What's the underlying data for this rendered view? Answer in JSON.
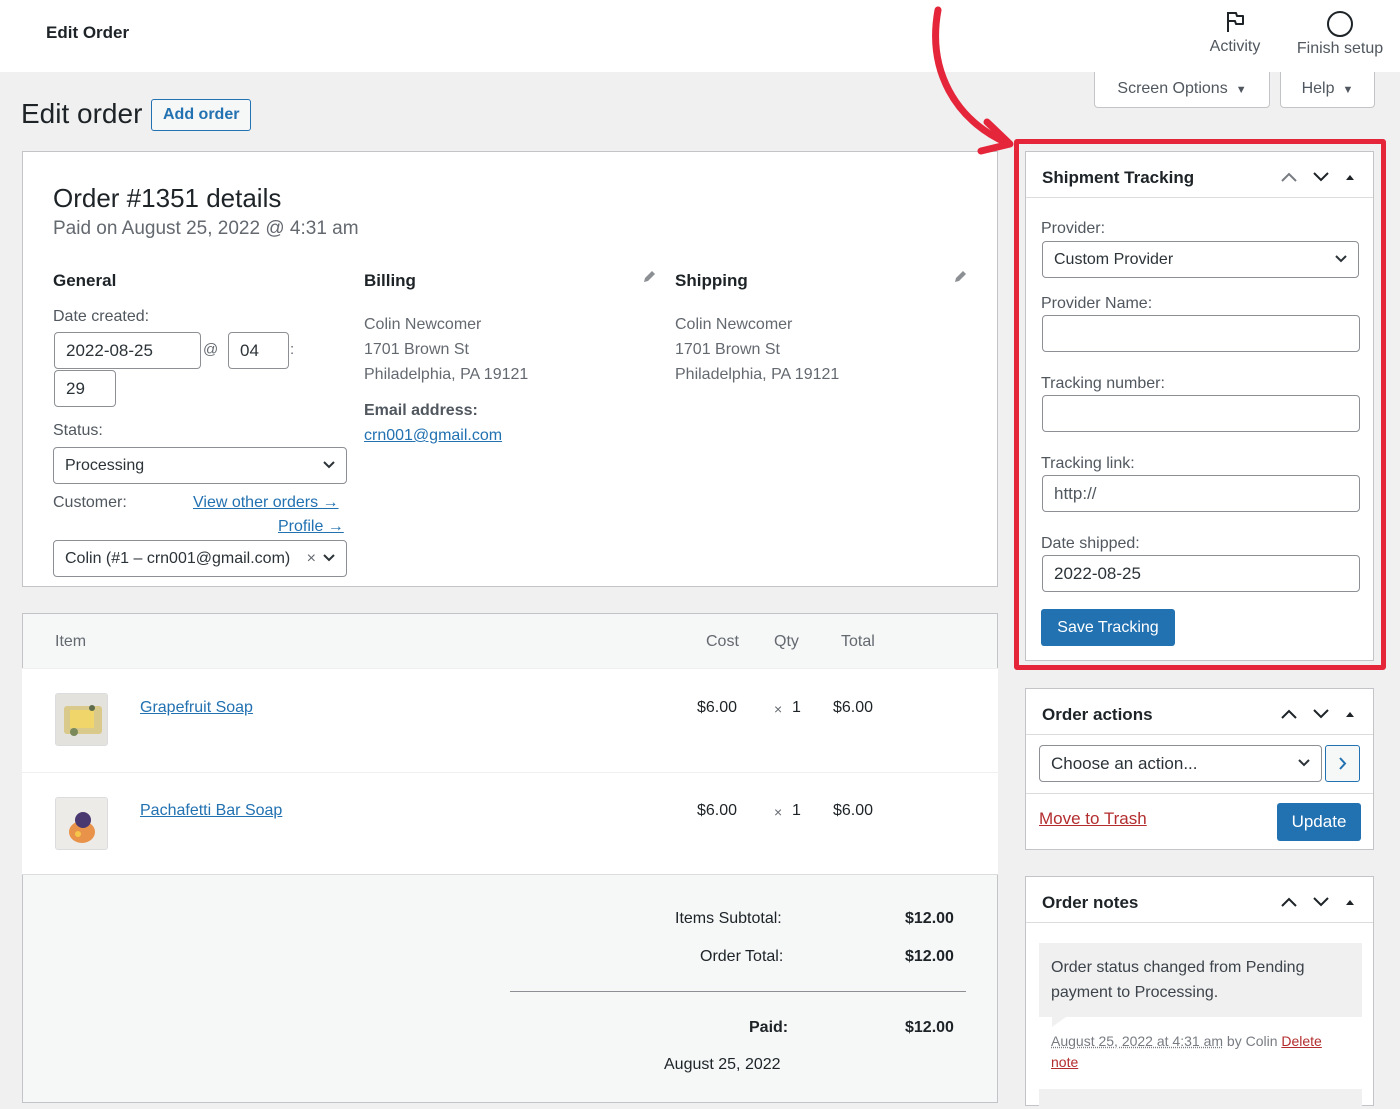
{
  "header": {
    "title": "Edit Order",
    "activity_label": "Activity",
    "finish_setup_label": "Finish setup",
    "screen_options_label": "Screen Options",
    "help_label": "Help"
  },
  "page": {
    "heading": "Edit order",
    "add_order_label": "Add order"
  },
  "order": {
    "title": "Order #1351 details",
    "paid_on": "Paid on August 25, 2022 @ 4:31 am",
    "general": {
      "heading": "General",
      "date_created_label": "Date created:",
      "date": "2022-08-25",
      "at": "@",
      "hour": "04",
      "colon": ":",
      "minute": "29",
      "status_label": "Status:",
      "status_value": "Processing",
      "customer_label": "Customer:",
      "view_other_orders": "View other orders →",
      "profile": "Profile →",
      "customer_value": "Colin (#1 – crn001@gmail.com)",
      "clear_symbol": "×"
    },
    "billing": {
      "heading": "Billing",
      "name": "Colin Newcomer",
      "street": "1701 Brown St",
      "city": "Philadelphia, PA 19121",
      "email_label": "Email address:",
      "email": "crn001@gmail.com"
    },
    "shipping": {
      "heading": "Shipping",
      "name": "Colin Newcomer",
      "street": "1701 Brown St",
      "city": "Philadelphia, PA 19121"
    }
  },
  "items": {
    "columns": {
      "item": "Item",
      "cost": "Cost",
      "qty": "Qty",
      "total": "Total"
    },
    "rows": [
      {
        "name": "Grapefruit Soap",
        "cost": "$6.00",
        "times": "×",
        "qty": "1",
        "total": "$6.00"
      },
      {
        "name": "Pachafetti Bar Soap",
        "cost": "$6.00",
        "times": "×",
        "qty": "1",
        "total": "$6.00"
      }
    ],
    "totals": {
      "subtotal_label": "Items Subtotal:",
      "subtotal_value": "$12.00",
      "order_total_label": "Order Total:",
      "order_total_value": "$12.00",
      "paid_label": "Paid:",
      "paid_value": "$12.00",
      "paid_date": "August 25, 2022"
    }
  },
  "shipment_tracking": {
    "title": "Shipment Tracking",
    "provider_label": "Provider:",
    "provider_value": "Custom Provider",
    "provider_name_label": "Provider Name:",
    "provider_name_value": "",
    "tracking_number_label": "Tracking number:",
    "tracking_number_value": "",
    "tracking_link_label": "Tracking link:",
    "tracking_link_placeholder": "http://",
    "date_shipped_label": "Date shipped:",
    "date_shipped_value": "2022-08-25",
    "save_label": "Save Tracking"
  },
  "order_actions": {
    "title": "Order actions",
    "action_select": "Choose an action...",
    "move_to_trash": "Move to Trash",
    "update_label": "Update"
  },
  "order_notes": {
    "title": "Order notes",
    "note_text": "Order status changed from Pending payment to Processing.",
    "note_meta_date": "August 25, 2022 at 4:31 am",
    "note_meta_by": " by Colin ",
    "delete_word": "Delete",
    "note_word": "note"
  },
  "colors": {
    "accent": "#2271b1",
    "highlight_border": "#e5263a",
    "annotation_arrow": "#e5263a",
    "trash_link": "#b32d2e"
  }
}
